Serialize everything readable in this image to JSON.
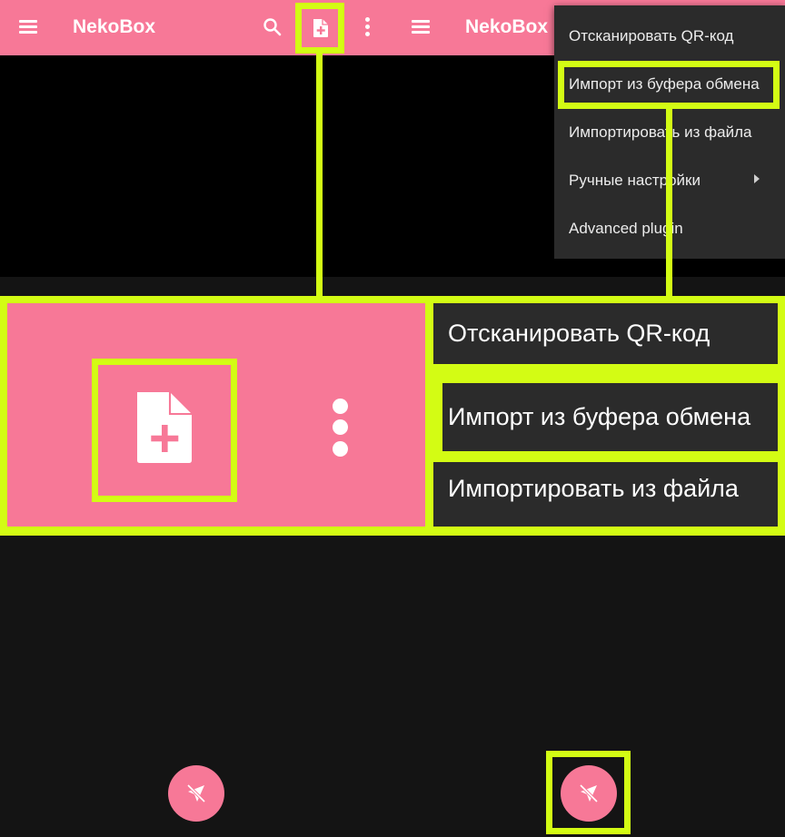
{
  "left_screen": {
    "appbar": {
      "title": "NekoBox",
      "menu_icon": "hamburger-icon",
      "search_icon": "search-icon",
      "add_icon": "file-add-icon",
      "more_icon": "more-vert-icon"
    },
    "fab": {
      "icon": "send-off-icon"
    }
  },
  "right_screen": {
    "appbar": {
      "title": "NekoBox",
      "menu_icon": "hamburger-icon"
    },
    "dropdown": {
      "items": [
        {
          "label": "Отсканировать QR-код"
        },
        {
          "label": "Импорт из буфера обмена"
        },
        {
          "label": "Импортировать из файла"
        },
        {
          "label": "Ручные настройки",
          "has_submenu": true
        },
        {
          "label": "Advanced plugin"
        }
      ]
    },
    "fab": {
      "icon": "send-off-icon"
    }
  },
  "zoom_callout": {
    "icons": [
      "file-add-icon",
      "more-vert-icon"
    ],
    "items": [
      {
        "label": "Отсканировать QR-код"
      },
      {
        "label": "Импорт из буфера обмена"
      },
      {
        "label": "Импортировать из файла"
      }
    ]
  },
  "colors": {
    "accent": "#f77897",
    "highlight": "#d3fc14",
    "menu_bg": "#2b2b2b",
    "background": "#141414"
  }
}
